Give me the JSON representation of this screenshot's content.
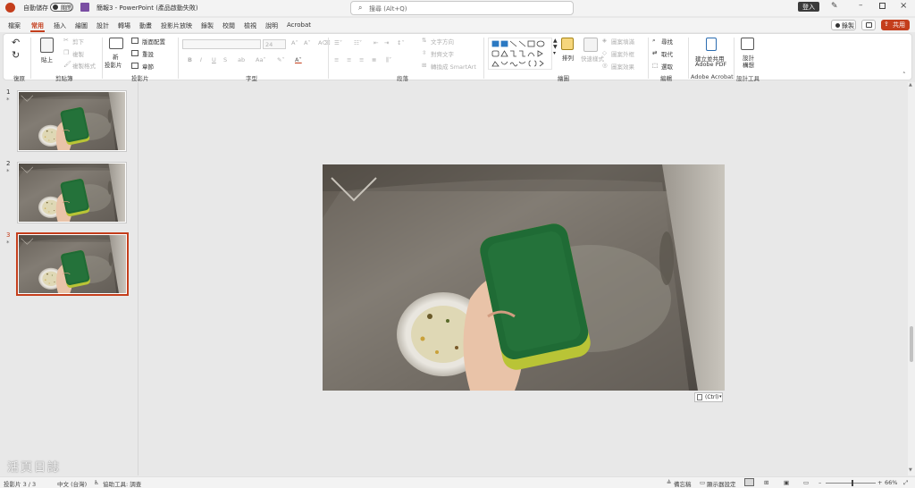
{
  "titlebar": {
    "autosave_label": "自動儲存",
    "autosave_state": "關閉",
    "doc_title": "簡報3 - PowerPoint (產品啟動失敗)",
    "search_placeholder": "搜尋 (Alt+Q)",
    "signin_label": "登入"
  },
  "tabs": [
    "檔案",
    "常用",
    "插入",
    "繪圖",
    "設計",
    "轉場",
    "動畫",
    "投影片放映",
    "錄製",
    "校閱",
    "檢視",
    "說明",
    "Acrobat"
  ],
  "active_tab": "常用",
  "header_actions": {
    "record_label": "錄製",
    "share_label": "共用"
  },
  "ribbon": {
    "undo_group": "復原",
    "clipboard": {
      "paste": "貼上",
      "cut": "剪下",
      "copy": "複製",
      "format_painter": "複製格式",
      "group": "剪貼簿"
    },
    "slides": {
      "new_slide_1": "新",
      "new_slide_2": "投影片",
      "layout": "版面配置",
      "reset": "重設",
      "section": "章節",
      "group": "投影片"
    },
    "font": {
      "font_size": "24",
      "group": "字型"
    },
    "paragraph": {
      "text_direction": "文字方向",
      "align_text": "對齊文字",
      "smartart": "轉換成 SmartArt",
      "group": "段落"
    },
    "drawing": {
      "arrange": "排列",
      "quick_styles": "快速樣式",
      "shape_fill": "圖案填滿",
      "shape_outline": "圖案外框",
      "shape_effects": "圖案效果",
      "group": "繪圖"
    },
    "editing": {
      "find": "尋找",
      "replace": "取代",
      "select": "選取",
      "group": "編輯"
    },
    "acrobat": {
      "create_pdf_1": "建立並共用",
      "create_pdf_2": "Adobe PDF",
      "group": "Adobe Acrobat"
    },
    "designer": {
      "ideas_1": "設計",
      "ideas_2": "構想",
      "group": "設計工具"
    }
  },
  "thumbnails": [
    {
      "number": "1",
      "star": "*"
    },
    {
      "number": "2",
      "star": "*"
    },
    {
      "number": "3",
      "star": "*"
    }
  ],
  "selected_slide": "3",
  "paste_options_label": "(Ctrl)",
  "watermark": "活頁日誌",
  "statusbar": {
    "slide_pos": "投影片 3 / 3",
    "language": "中文 (台灣)",
    "accessibility": "協助工具: 調查",
    "notes": "備忘稿",
    "display_settings": "顯示器設定",
    "zoom": "66%"
  },
  "colors": {
    "accent": "#c43e1c",
    "sponge_green": "#1f6b35",
    "sponge_yellow": "#b9c436"
  }
}
